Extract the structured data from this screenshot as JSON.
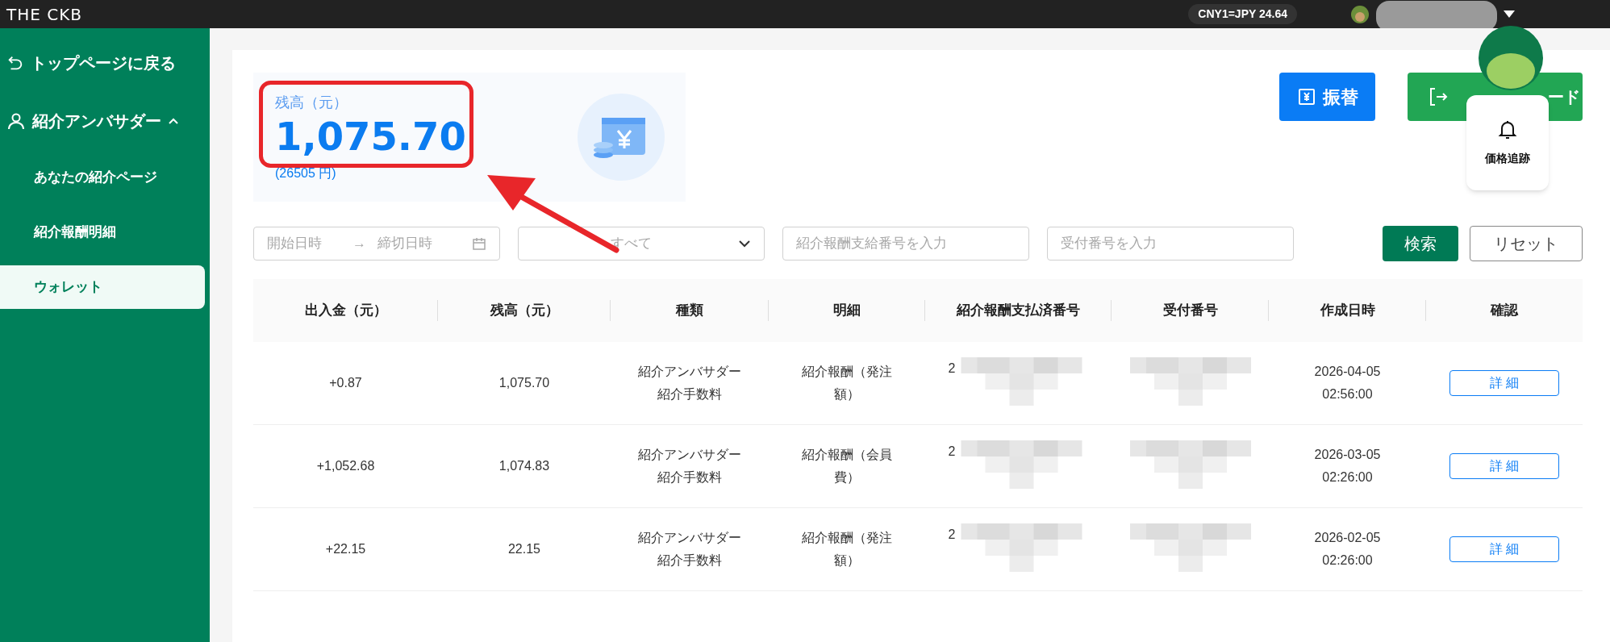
{
  "header": {
    "logo": "THE CKB",
    "rate": "CNY1=JPY 24.64"
  },
  "sidebar": {
    "back": "トップページに戻る",
    "section": {
      "label": "紹介アンバサダー",
      "expanded": true
    },
    "items": [
      {
        "label": "あなたの紹介ページ",
        "selected": false
      },
      {
        "label": "紹介報酬明細",
        "selected": false
      },
      {
        "label": "ウォレット",
        "selected": true
      }
    ]
  },
  "balance": {
    "label": "残高（元）",
    "amount": "1,075.70",
    "jpy": "(26505 円)"
  },
  "actions": {
    "transfer": "振替",
    "download": "ード"
  },
  "price_tracking": {
    "label": "価格追跡"
  },
  "filters": {
    "start_placeholder": "開始日時",
    "arrow": "→",
    "end_placeholder": "締切日時",
    "type_value": "すべて",
    "payout_placeholder": "紹介報酬支給番号を入力",
    "receipt_placeholder": "受付番号を入力",
    "search": "検索",
    "reset": "リセット"
  },
  "table": {
    "columns": [
      "出入金（元）",
      "残高（元）",
      "種類",
      "明細",
      "紹介報酬支払済番号",
      "受付番号",
      "作成日時",
      "確認"
    ],
    "rows": [
      {
        "amount": "+0.87",
        "balance": "1,075.70",
        "type": [
          "紹介アンバサダー",
          "紹介手数料"
        ],
        "detail": [
          "紹介報酬（発注",
          "額）"
        ],
        "payout_no": "2",
        "created": [
          "2026-04-05",
          "02:56:00"
        ],
        "button": "詳 細"
      },
      {
        "amount": "+1,052.68",
        "balance": "1,074.83",
        "type": [
          "紹介アンバサダー",
          "紹介手数料"
        ],
        "detail": [
          "紹介報酬（会員",
          "費）"
        ],
        "payout_no": "2",
        "created": [
          "2026-03-05",
          "02:26:00"
        ],
        "button": "詳 細"
      },
      {
        "amount": "+22.15",
        "balance": "22.15",
        "type": [
          "紹介アンバサダー",
          "紹介手数料"
        ],
        "detail": [
          "紹介報酬（発注",
          "額）"
        ],
        "payout_no": "2",
        "created": [
          "2026-02-05",
          "02:26:00"
        ],
        "button": "詳 細"
      }
    ]
  }
}
